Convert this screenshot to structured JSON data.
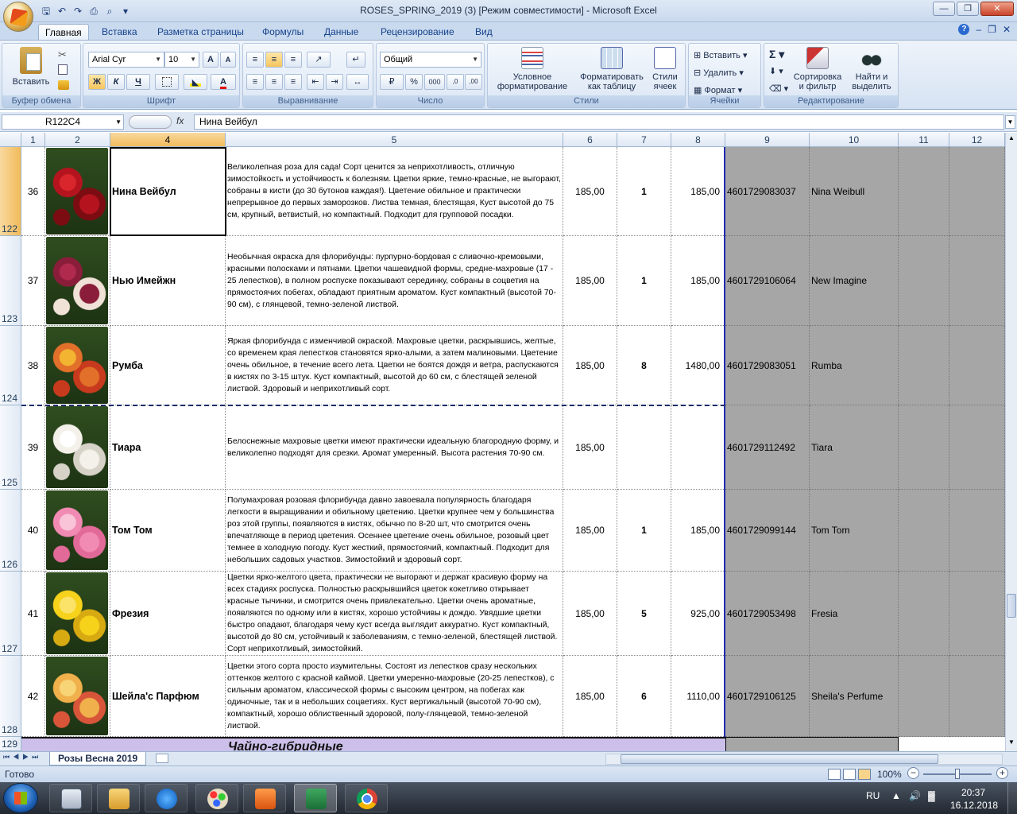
{
  "window": {
    "title": "ROSES_SPRING_2019 (3)  [Режим совместимости] - Microsoft Excel"
  },
  "tabs": [
    "Главная",
    "Вставка",
    "Разметка страницы",
    "Формулы",
    "Данные",
    "Рецензирование",
    "Вид"
  ],
  "ribbon": {
    "clipboard": {
      "paste": "Вставить",
      "label": "Буфер обмена"
    },
    "font": {
      "name": "Arial Cyr",
      "size": "10",
      "bold": "Ж",
      "italic": "К",
      "underline": "Ч",
      "label": "Шрифт"
    },
    "alignment": {
      "label": "Выравнивание"
    },
    "number": {
      "format": "Общий",
      "label": "Число"
    },
    "styles": {
      "cond_format_1": "Условное",
      "cond_format_2": "форматирование",
      "format_table_1": "Форматировать",
      "format_table_2": "как таблицу",
      "cell_styles_1": "Стили",
      "cell_styles_2": "ячеек",
      "label": "Стили"
    },
    "cells": {
      "insert": "Вставить",
      "delete": "Удалить",
      "format": "Формат",
      "label": "Ячейки"
    },
    "editing": {
      "sort_1": "Сортировка",
      "sort_2": "и фильтр",
      "find_1": "Найти и",
      "find_2": "выделить",
      "label": "Редактирование"
    }
  },
  "formula_bar": {
    "name_box": "R122C4",
    "fx": "fx",
    "value": "Нина Вейбул"
  },
  "columns": [
    "1",
    "2",
    "4",
    "5",
    "6",
    "7",
    "8",
    "9",
    "10",
    "11",
    "12"
  ],
  "rows": [
    {
      "row": "122",
      "n": "36",
      "name": "Нина Вейбул",
      "desc": "Великолепная роза для сада! Сорт ценится за неприхотливость, отличную зимостойкость и устойчивость к болезням. Цветки яркие, темно-красные, не выгорают, собраны в кисти (до 30 бутонов каждая!). Цветение обильное и практически непрерывное до первых заморозков. Листва темная, блестящая, Куст высотой до 75 см, крупный, ветвистый, но компактный. Подходит для групповой посадки.",
      "price": "185,00",
      "qty": "1",
      "sum": "185,00",
      "code": "4601729083037",
      "latin": "Nina Weibull"
    },
    {
      "row": "123",
      "n": "37",
      "name": "Нью Имейжн",
      "desc": "Необычная окраска для флорибунды: пурпурно-бордовая с сливочно-кремовыми, красными полосками и пятнами. Цветки чашевидной формы, средне-махровые (17 - 25 лепестков), в полном роспуске показывают серединку, собраны в соцветия на прямостоячих побегах, обладают приятным ароматом. Куст компактный (высотой 70-90 см), с глянцевой, темно-зеленой листвой.",
      "price": "185,00",
      "qty": "1",
      "sum": "185,00",
      "code": "4601729106064",
      "latin": "New Imagine"
    },
    {
      "row": "124",
      "n": "38",
      "name": "Румба",
      "desc": "Яркая флорибунда с изменчивой окраской. Махровые цветки, раскрывшись, желтые, со временем края лепестков становятся ярко-алыми, а затем малиновыми. Цветение очень обильное, в течение всего лета. Цветки не боятся дождя и ветра, распускаются в кистях по 3-15 штук. Куст компактный, высотой до 60 см, с блестящей зеленой листвой. Здоровый и неприхотливый сорт.",
      "price": "185,00",
      "qty": "8",
      "sum": "1480,00",
      "code": "4601729083051",
      "latin": "Rumba"
    },
    {
      "row": "125",
      "n": "39",
      "name": "Тиара",
      "desc": "Белоснежные махровые цветки имеют практически идеальную благородную форму, и великолепно подходят для срезки. Аромат умеренный. Высота растения 70-90 см.",
      "price": "185,00",
      "qty": "",
      "sum": "",
      "code": "4601729112492",
      "latin": "Tiara"
    },
    {
      "row": "126",
      "n": "40",
      "name": "Том Том",
      "desc": "Полумахровая розовая флорибунда давно завоевала популярность благодаря легкости в выращивании и обильному цветению. Цветки крупнее чем у большинства роз этой группы, появляются в кистях, обычно по 8-20 шт, что смотрится очень впечатляюще в период цветения. Осеннее цветение очень обильное, розовый цвет темнее в холодную погоду. Куст жесткий, прямостоячий, компактный. Подходит для небольших садовых участков. Зимостойкий и здоровый сорт.",
      "price": "185,00",
      "qty": "1",
      "sum": "185,00",
      "code": "4601729099144",
      "latin": "Tom Tom"
    },
    {
      "row": "127",
      "n": "41",
      "name": "Фрезия",
      "desc": "Цветки ярко-желтого цвета, практически не выгорают и держат красивую форму на всех стадиях роспуска. Полностью раскрывшийся цветок кокетливо открывает красные тычинки, и смотрится очень привлекательно. Цветки очень ароматные, появляются по одному или в кистях, хорошо устойчивы к дождю. Увядшие цветки быстро опадают, благодаря чему куст всегда выглядит аккуратно. Куст компактный, высотой до 80 см, устойчивый к заболеваниям, с темно-зеленой, блестящей листвой. Сорт неприхотливый, зимостойкий.",
      "price": "185,00",
      "qty": "5",
      "sum": "925,00",
      "code": "4601729053498",
      "latin": "Fresia"
    },
    {
      "row": "128",
      "n": "42",
      "name": "Шейла'с Парфюм",
      "desc": "Цветки этого сорта просто изумительны. Состоят из лепестков сразу нескольких оттенков желтого с красной каймой. Цветки умеренно-махровые (20-25 лепестков), с сильным ароматом, классической формы с высоким центром, на побегах как одиночные, так и в небольших соцветиях. Куст вертикальный (высотой 70-90 см), компактный, хорошо облиственный здоровой, полу-глянцевой, темно-зеленой листвой.",
      "price": "185,00",
      "qty": "6",
      "sum": "1110,00",
      "code": "4601729106125",
      "latin": "Sheila's Perfume"
    }
  ],
  "section_row": {
    "row": "129",
    "title": "Чайно-гибридные"
  },
  "sheet_tab": "Розы Весна 2019",
  "status": {
    "ready": "Готово",
    "zoom": "100%"
  },
  "taskbar": {
    "lang": "RU",
    "time": "20:37",
    "date": "16.12.2018"
  }
}
